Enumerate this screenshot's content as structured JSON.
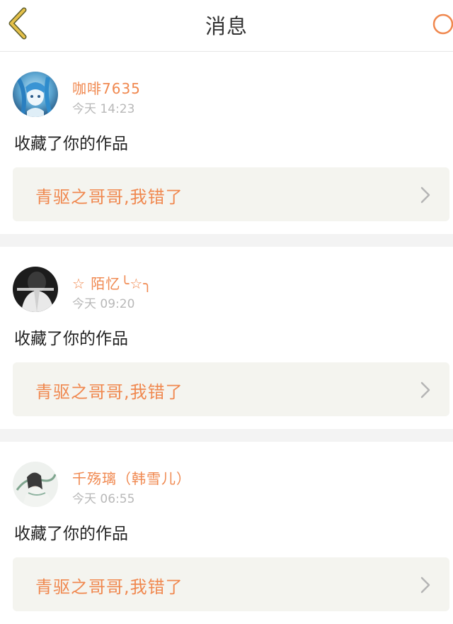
{
  "header": {
    "title": "消息",
    "back_icon": "chevron-left-icon",
    "refresh_icon": "circle-icon",
    "accent_color": "#f0884f",
    "back_icon_color": "#e5c14a"
  },
  "messages": [
    {
      "user": "咖啡7635",
      "time": "今天 14:23",
      "action": "收藏了你的作品",
      "work_title": "青驱之哥哥,我错了",
      "avatar": "anime-avatar-blue"
    },
    {
      "user": "☆ 陌忆╰☆╮",
      "time": "今天 09:20",
      "action": "收藏了你的作品",
      "work_title": "青驱之哥哥,我错了",
      "avatar": "monochrome-avatar"
    },
    {
      "user": "千殇璃（韩雪儿）",
      "time": "今天 06:55",
      "action": "收藏了你的作品",
      "work_title": "青驱之哥哥,我错了",
      "avatar": "ink-painting-avatar"
    }
  ]
}
